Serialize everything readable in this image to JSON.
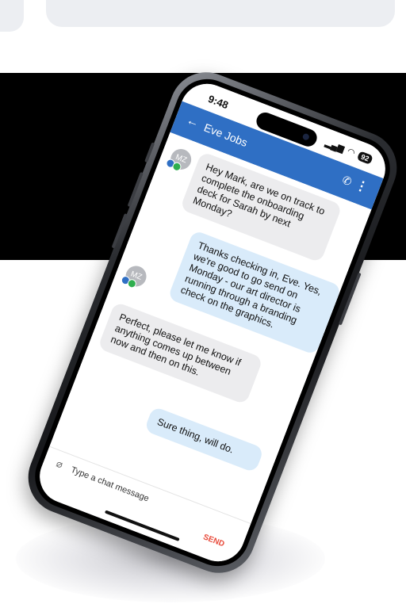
{
  "status_bar": {
    "time": "9:48",
    "signal_icon": "signal-bars-icon",
    "wifi_icon": "wifi-icon",
    "battery": "92"
  },
  "header": {
    "contact_name": "Eve Jobs",
    "back_icon": "arrow-left-icon",
    "call_icon": "phone-icon",
    "menu_icon": "more-vertical-icon",
    "color": "#2f6fc4"
  },
  "messages": [
    {
      "direction": "incoming",
      "avatar": "MZ",
      "text": "Hey Mark, are we on track to complete the onboarding deck for Sarah by next Monday?"
    },
    {
      "direction": "outgoing",
      "text": "Thanks checking in, Eve. Yes, we're good to go send on Monday - our art director is running through a branding check on the graphics."
    },
    {
      "direction": "incoming",
      "avatar": "MZ",
      "text": "Perfect, please let me know if anything comes up between now and then on this."
    },
    {
      "direction": "outgoing",
      "text": "Sure thing, will do."
    }
  ],
  "composer": {
    "placeholder": "Type a chat message",
    "send_label": "SEND",
    "attach_icon": "paperclip-icon"
  },
  "colors": {
    "incoming_bubble": "#ececee",
    "outgoing_bubble": "#d9ebfa",
    "send": "#e84a3a"
  }
}
